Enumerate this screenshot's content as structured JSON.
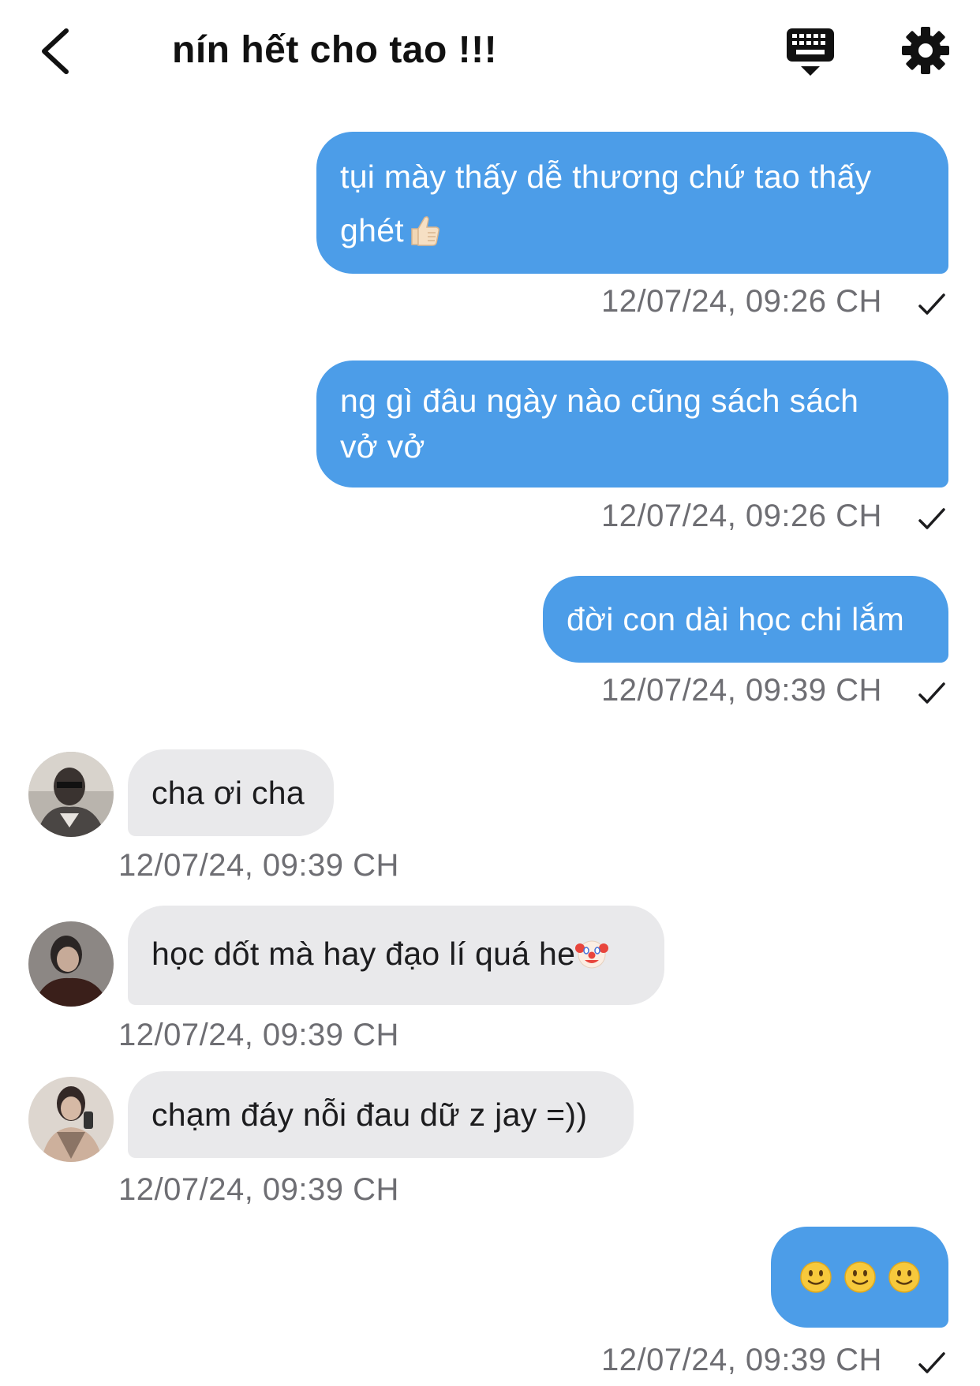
{
  "header": {
    "title": "nín hết cho tao !!!",
    "back_icon": "chevron-left-icon",
    "keyboard_icon": "keyboard-icon",
    "settings_icon": "gear-icon"
  },
  "colors": {
    "outgoing_bubble": "#4c9de8",
    "incoming_bubble": "#e9e9eb",
    "timestamp": "#6e6e73"
  },
  "messages": [
    {
      "direction": "out",
      "lines": [
        "tụi mày thấy dễ thương chứ tao thấy",
        "ghét "
      ],
      "emoji": "thumbs-up",
      "timestamp": "12/07/24, 09:26 CH",
      "read": true
    },
    {
      "direction": "out",
      "lines": [
        "ng gì đâu ngày nào cũng sách sách",
        "vở vở"
      ],
      "timestamp": "12/07/24, 09:26 CH",
      "read": true
    },
    {
      "direction": "out",
      "lines": [
        "đời con dài học chi lắm"
      ],
      "timestamp": "12/07/24, 09:39 CH",
      "read": true
    },
    {
      "direction": "in",
      "lines": [
        "cha ơi cha"
      ],
      "timestamp": "12/07/24, 09:39 CH",
      "avatar": "avatar-1"
    },
    {
      "direction": "in",
      "lines": [
        "học dốt mà hay đạo lí quá he"
      ],
      "emoji": "clown-face",
      "timestamp": "12/07/24, 09:39 CH",
      "avatar": "avatar-2"
    },
    {
      "direction": "in",
      "lines": [
        "chạm đáy nỗi đau dữ z jay =))"
      ],
      "timestamp": "12/07/24, 09:39 CH",
      "avatar": "avatar-3"
    },
    {
      "direction": "out",
      "lines": [
        ""
      ],
      "emoji": "slightly-smiling-face x3",
      "timestamp": "12/07/24, 09:39 CH",
      "read": true
    }
  ]
}
